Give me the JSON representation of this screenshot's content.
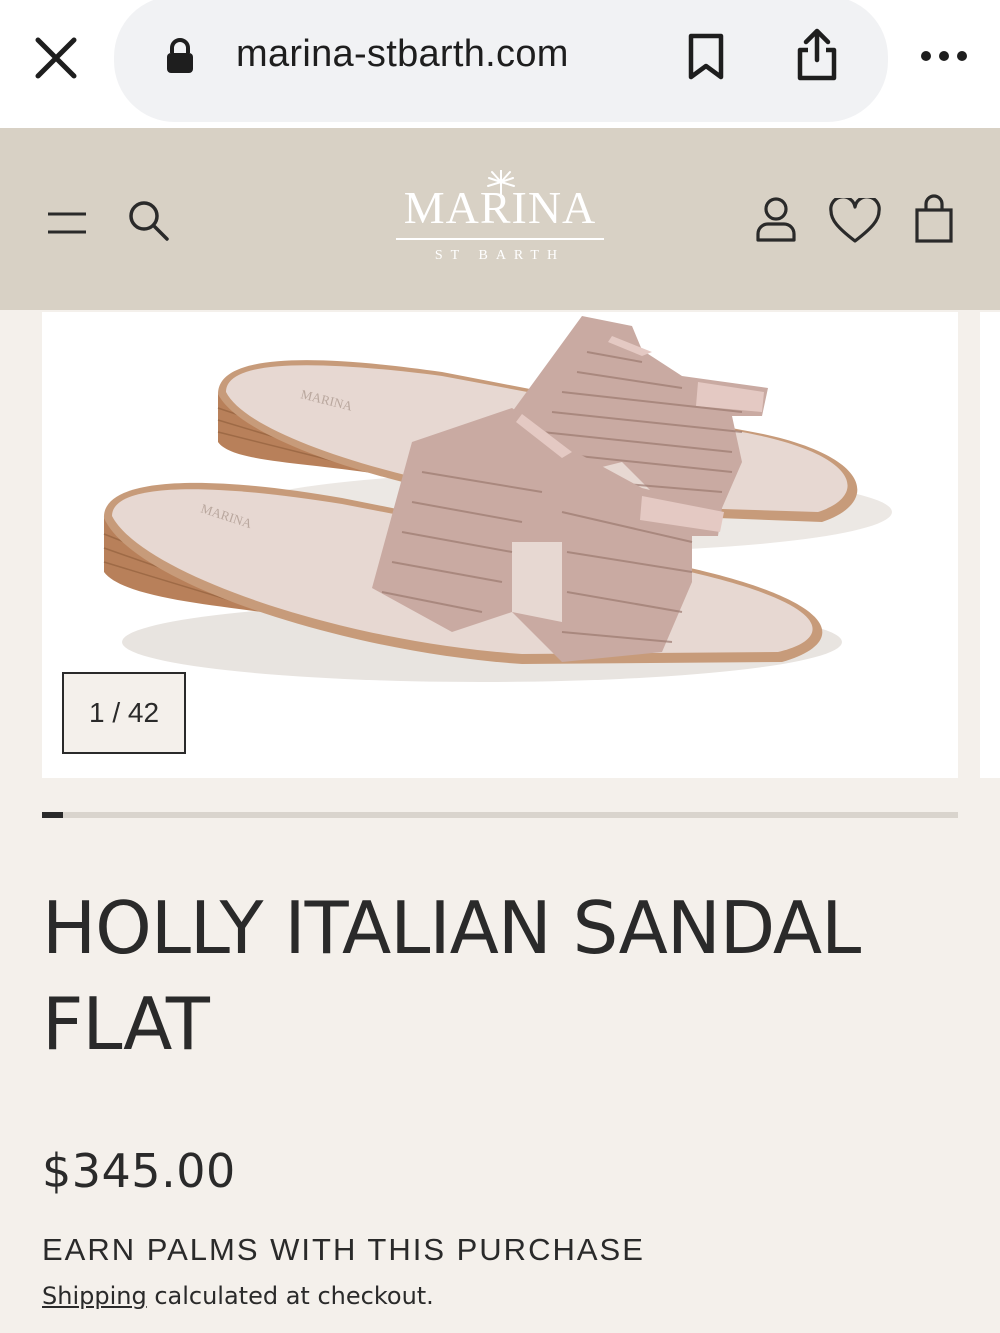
{
  "browser": {
    "url": "marina-stbarth.com",
    "icons": [
      "close-icon",
      "lock-icon",
      "bookmark-icon",
      "share-icon",
      "more-icon"
    ]
  },
  "header": {
    "logo_main": "MARINA",
    "logo_sub": "ST BARTH",
    "icons": [
      "menu-icon",
      "search-icon",
      "account-icon",
      "wishlist-icon",
      "cart-icon"
    ],
    "background_color": "#d8d1c5"
  },
  "gallery": {
    "counter": "1 / 42",
    "current_slide": 1,
    "total_slides": 42,
    "progress_fraction": 0.023
  },
  "product": {
    "title": "HOLLY ITALIAN SANDAL FLAT",
    "price": "$345.00",
    "earn_palms": "EARN PALMS WITH THIS PURCHASE",
    "shipping_link": "Shipping",
    "shipping_rest": " calculated at checkout."
  },
  "colors": {
    "page_background": "#f4f0eb",
    "text": "#2a2a2a",
    "accent_dark": "#2a2a2a"
  }
}
